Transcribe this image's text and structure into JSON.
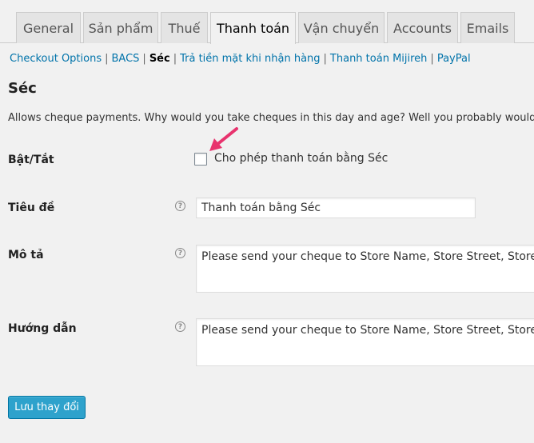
{
  "tabs": [
    {
      "label": "General"
    },
    {
      "label": "Sản phẩm"
    },
    {
      "label": "Thuế"
    },
    {
      "label": "Thanh toán"
    },
    {
      "label": "Vận chuyển"
    },
    {
      "label": "Accounts"
    },
    {
      "label": "Emails"
    }
  ],
  "subnav": {
    "items": [
      "Checkout Options",
      "BACS",
      "Séc",
      "Trả tiền mặt khi nhận hàng",
      "Thanh toán Mijireh",
      "PayPal"
    ],
    "separator": "|"
  },
  "section": {
    "title": "Séc",
    "description": "Allows cheque payments. Why would you take cheques in this day and age? Well you probably wouldn't but it does allow you to make test purchases for testing order emails and the 'success' pages etc."
  },
  "fields": {
    "enable": {
      "label": "Bật/Tắt",
      "checkbox_label": "Cho phép thanh toán bằng Séc"
    },
    "title": {
      "label": "Tiêu đề",
      "value": "Thanh toán bằng Séc"
    },
    "description": {
      "label": "Mô tả",
      "value": "Please send your cheque to Store Name, Store Street, Store Town, Store State / County, Store Postcode."
    },
    "instructions": {
      "label": "Hướng dẫn",
      "value": "Please send your cheque to Store Name, Store Street, Store Town, Store State / County, Store Postcode."
    }
  },
  "help_glyph": "?",
  "save_label": "Lưu thay đổi",
  "colors": {
    "accent": "#2ea2cc",
    "link": "#0073aa",
    "annotation_arrow": "#e8336e"
  }
}
